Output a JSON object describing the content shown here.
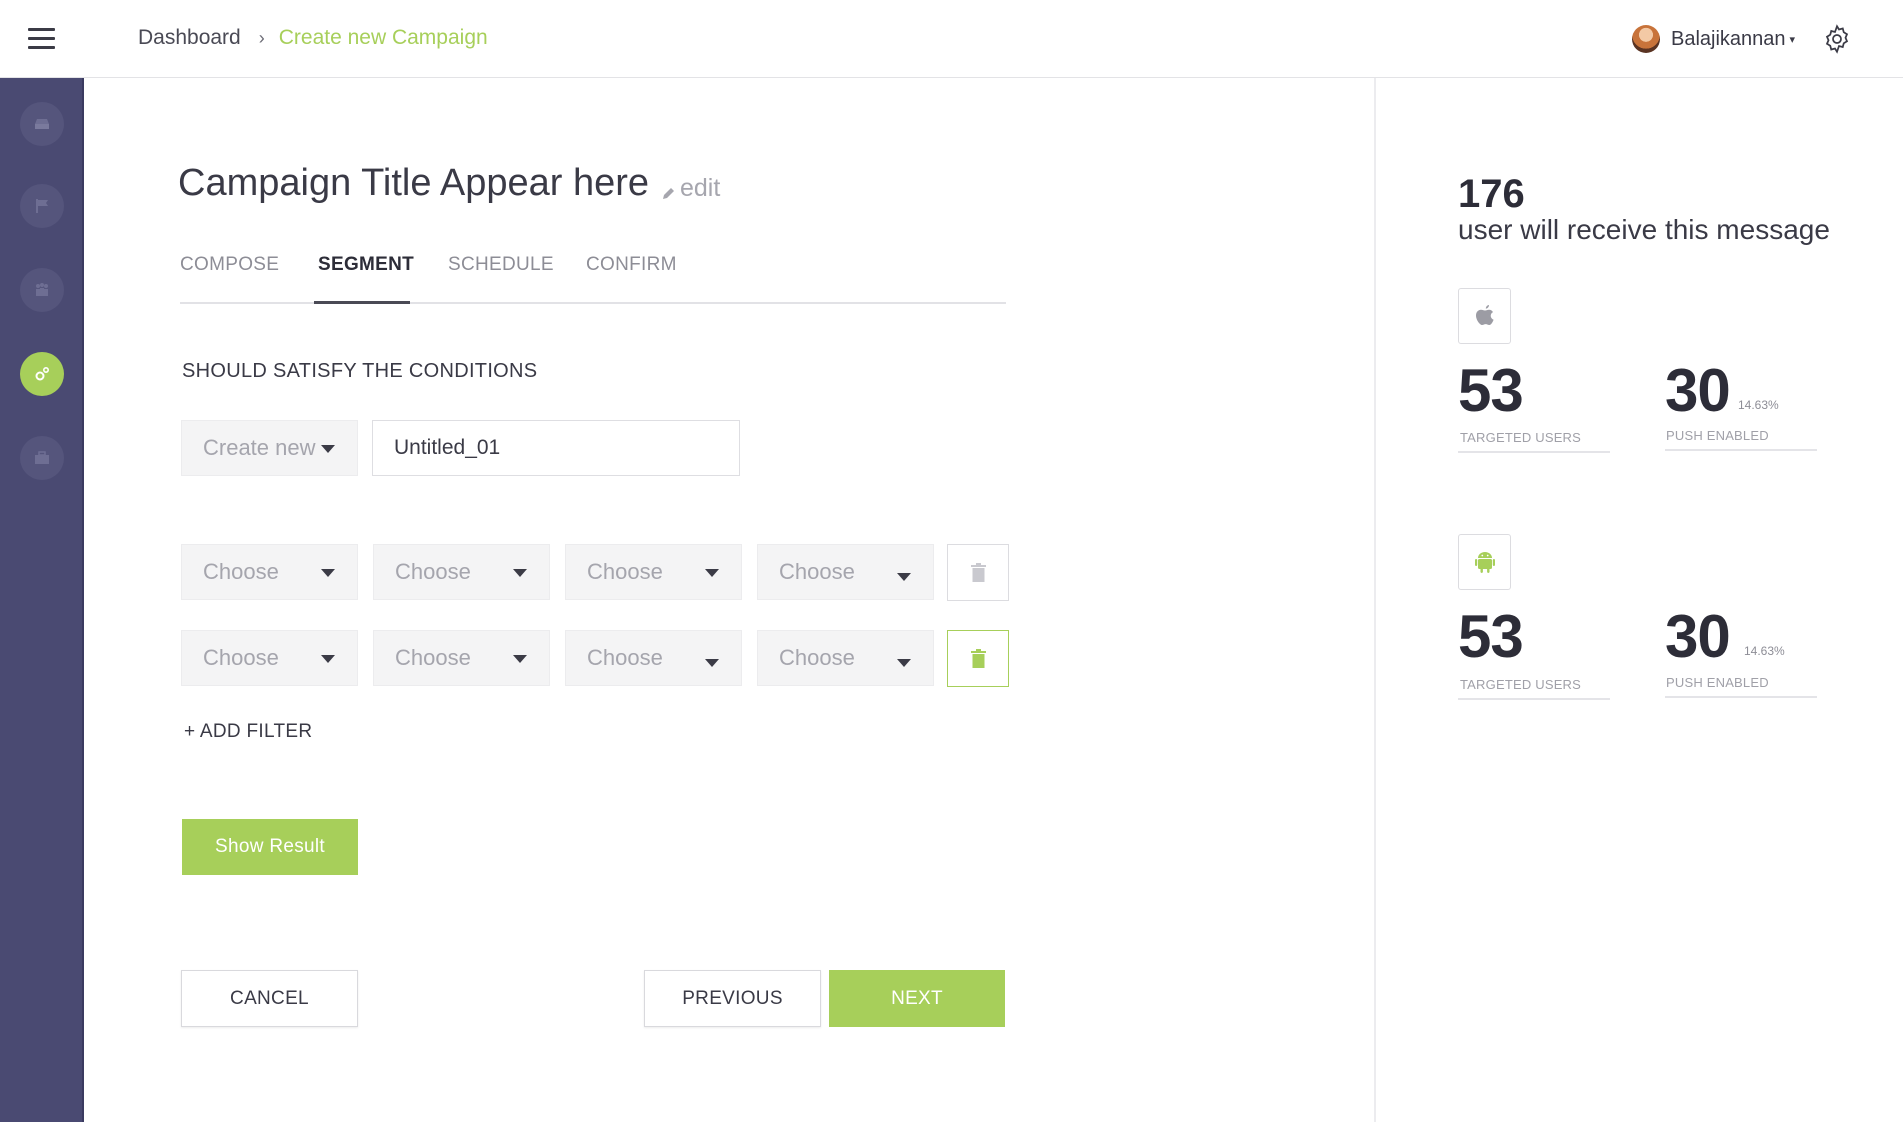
{
  "header": {
    "breadcrumb": {
      "home": "Dashboard",
      "separator": "›",
      "current": "Create new Campaign"
    },
    "user": {
      "name": "Balajikannan",
      "caret": "▾"
    }
  },
  "sidebar": {
    "items": [
      {
        "icon": "inbox-icon"
      },
      {
        "icon": "flag-icon"
      },
      {
        "icon": "users-icon"
      },
      {
        "icon": "segment-icon",
        "active": true
      },
      {
        "icon": "briefcase-icon"
      }
    ]
  },
  "campaign": {
    "title": "Campaign Title Appear here",
    "edit_label": "edit"
  },
  "tabs": [
    "COMPOSE",
    "SEGMENT",
    "SCHEDULE",
    "CONFIRM"
  ],
  "active_tab": "SEGMENT",
  "segment": {
    "section_label": "SHOULD SATISFY THE CONDITIONS",
    "create_select": "Create new",
    "name_value": "Untitled_01",
    "filters": [
      [
        "Choose",
        "Choose",
        "Choose",
        "Choose"
      ],
      [
        "Choose",
        "Choose",
        "Choose",
        "Choose"
      ]
    ],
    "add_filter": "+ ADD FILTER",
    "show_result": "Show Result"
  },
  "actions": {
    "cancel": "CANCEL",
    "previous": "PREVIOUS",
    "next": "NEXT"
  },
  "summary": {
    "total": "176",
    "total_label": "user will receive this message",
    "platforms": [
      {
        "icon": "apple-icon",
        "targeted": "53",
        "targeted_label": "TARGETED USERS",
        "push": "30",
        "push_pct": "14.63%",
        "push_label": "PUSH ENABLED"
      },
      {
        "icon": "android-icon",
        "targeted": "53",
        "targeted_label": "TARGETED USERS",
        "push": "30",
        "push_pct": "14.63%",
        "push_label": "PUSH ENABLED"
      }
    ]
  },
  "colors": {
    "accent": "#a7cf5a",
    "sidebar": "#4a4a72",
    "text": "#3a3a46"
  }
}
